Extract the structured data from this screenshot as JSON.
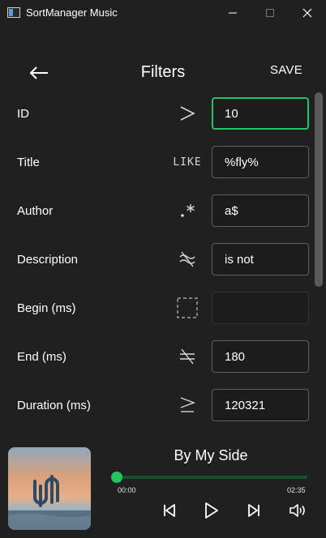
{
  "window": {
    "title": "SortManager Music"
  },
  "header": {
    "title": "Filters",
    "save_label": "SAVE"
  },
  "filters": [
    {
      "label": "ID",
      "operator": "greater-than",
      "value": "10",
      "focused": true
    },
    {
      "label": "Title",
      "operator": "like",
      "operator_text": "LIKE",
      "value": "%fly%"
    },
    {
      "label": "Author",
      "operator": "regex",
      "value": "a$"
    },
    {
      "label": "Description",
      "operator": "not-like",
      "value": "is not"
    },
    {
      "label": "Begin (ms)",
      "operator": "none",
      "value": ""
    },
    {
      "label": "End (ms)",
      "operator": "not-equal",
      "value": "180"
    },
    {
      "label": "Duration (ms)",
      "operator": "greater-or-equal",
      "value": "120321"
    }
  ],
  "player": {
    "song_title": "By My Side",
    "elapsed": "00:00",
    "total": "02:35",
    "progress": 0
  },
  "colors": {
    "accent": "#22c55e",
    "background": "#202020"
  }
}
